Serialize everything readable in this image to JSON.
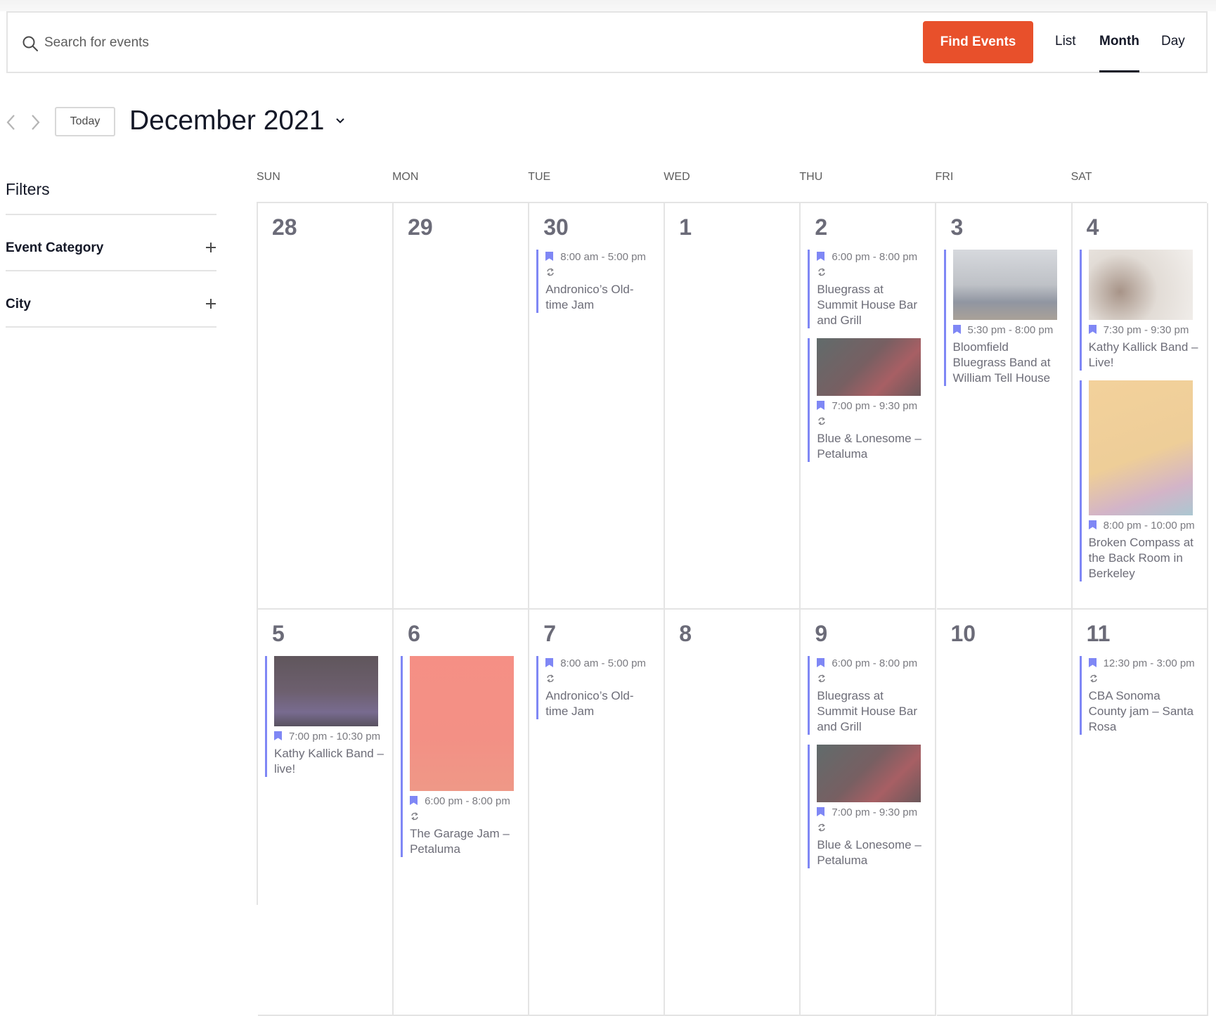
{
  "search": {
    "placeholder": "Search for events",
    "find_button": "Find Events",
    "views": [
      "List",
      "Month",
      "Day"
    ],
    "active_view": "Month"
  },
  "nav": {
    "today_label": "Today",
    "month_title": "December 2021"
  },
  "filters": {
    "title": "Filters",
    "groups": [
      {
        "label": "Event Category"
      },
      {
        "label": "City"
      }
    ]
  },
  "colors": {
    "accent": "#e8502b",
    "event_bar": "#7f87f5",
    "grid_line": "#e4e4e4"
  },
  "calendar": {
    "weekdays": [
      "SUN",
      "MON",
      "TUE",
      "WED",
      "THU",
      "FRI",
      "SAT"
    ],
    "weeks": [
      {
        "days": [
          {
            "num": "28",
            "events": []
          },
          {
            "num": "29",
            "events": []
          },
          {
            "num": "30",
            "events": [
              {
                "time": "8:00 am - 5:00 pm",
                "recurring": true,
                "title": "Andronico’s Old-time Jam",
                "image": null
              }
            ]
          },
          {
            "num": "1",
            "events": []
          },
          {
            "num": "2",
            "events": [
              {
                "time": "6:00 pm - 8:00 pm",
                "recurring": true,
                "title": "Bluegrass at Summit House Bar and Grill",
                "image": null
              },
              {
                "time": "7:00 pm - 9:30 pm",
                "recurring": true,
                "title": "Blue & Lonesome – Petaluma",
                "image": "blue-lonesome-photo"
              }
            ]
          },
          {
            "num": "3",
            "events": [
              {
                "time": "5:30 pm - 8:00 pm",
                "recurring": false,
                "title": "Bloomfield Bluegrass Band at William Tell House",
                "image": "bloomfield-band-photo"
              }
            ]
          },
          {
            "num": "4",
            "events": [
              {
                "time": "7:30 pm - 9:30 pm",
                "recurring": false,
                "title": "Kathy Kallick Band – Live!",
                "image": "kathy-kallick-photo"
              },
              {
                "time": "8:00 pm - 10:00 pm",
                "recurring": false,
                "title": "Broken Compass at the Back Room in Berkeley",
                "image": "broken-compass-poster"
              }
            ]
          }
        ]
      },
      {
        "days": [
          {
            "num": "5",
            "events": [
              {
                "time": "7:00 pm - 10:30 pm",
                "recurring": false,
                "title": "Kathy Kallick Band – live!",
                "image": "freight-salvage-stage-photo"
              }
            ]
          },
          {
            "num": "6",
            "events": [
              {
                "time": "6:00 pm - 8:00 pm",
                "recurring": true,
                "title": "The Garage Jam – Petaluma",
                "image": "garage-jam-poster"
              }
            ]
          },
          {
            "num": "7",
            "events": [
              {
                "time": "8:00 am - 5:00 pm",
                "recurring": true,
                "title": "Andronico’s Old-time Jam",
                "image": null
              }
            ]
          },
          {
            "num": "8",
            "events": []
          },
          {
            "num": "9",
            "events": [
              {
                "time": "6:00 pm - 8:00 pm",
                "recurring": true,
                "title": "Bluegrass at Summit House Bar and Grill",
                "image": null
              },
              {
                "time": "7:00 pm - 9:30 pm",
                "recurring": true,
                "title": "Blue & Lonesome – Petaluma",
                "image": "blue-lonesome-photo"
              }
            ]
          },
          {
            "num": "10",
            "events": []
          },
          {
            "num": "11",
            "events": [
              {
                "time": "12:30 pm - 3:00 pm",
                "recurring": true,
                "title": "CBA Sonoma County jam – Santa Rosa",
                "image": null
              }
            ]
          }
        ]
      }
    ]
  }
}
